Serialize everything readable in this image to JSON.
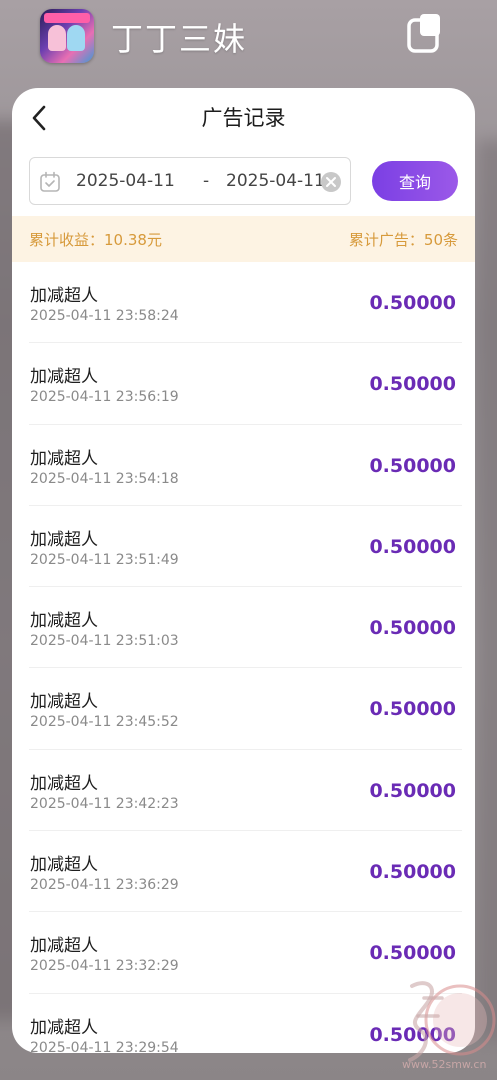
{
  "app": {
    "title": "丁丁三妹",
    "icon": "app-logo-icon"
  },
  "nav": {
    "title": "广告记录",
    "back_icon": "chevron-left-icon"
  },
  "filter": {
    "start_date": "2025-04-11",
    "separator": "-",
    "end_date": "2025-04-11",
    "query_label": "查询",
    "accent_color": "#7b3fe4"
  },
  "summary": {
    "earnings_label": "累计收益：",
    "earnings_value": "10.38元",
    "ads_label": "累计广告：",
    "ads_value": "50条",
    "color": "#d79a3b"
  },
  "records": [
    {
      "name": "加减超人",
      "time": "2025-04-11 23:58:24",
      "amount": "0.50000"
    },
    {
      "name": "加减超人",
      "time": "2025-04-11 23:56:19",
      "amount": "0.50000"
    },
    {
      "name": "加减超人",
      "time": "2025-04-11 23:54:18",
      "amount": "0.50000"
    },
    {
      "name": "加减超人",
      "time": "2025-04-11 23:51:49",
      "amount": "0.50000"
    },
    {
      "name": "加减超人",
      "time": "2025-04-11 23:51:03",
      "amount": "0.50000"
    },
    {
      "name": "加减超人",
      "time": "2025-04-11 23:45:52",
      "amount": "0.50000"
    },
    {
      "name": "加减超人",
      "time": "2025-04-11 23:42:23",
      "amount": "0.50000"
    },
    {
      "name": "加减超人",
      "time": "2025-04-11 23:36:29",
      "amount": "0.50000"
    },
    {
      "name": "加减超人",
      "time": "2025-04-11 23:32:29",
      "amount": "0.50000"
    },
    {
      "name": "加减超人",
      "time": "2025-04-11 23:29:54",
      "amount": "0.50000"
    }
  ],
  "watermark": {
    "url": "www.52smw.cn"
  }
}
